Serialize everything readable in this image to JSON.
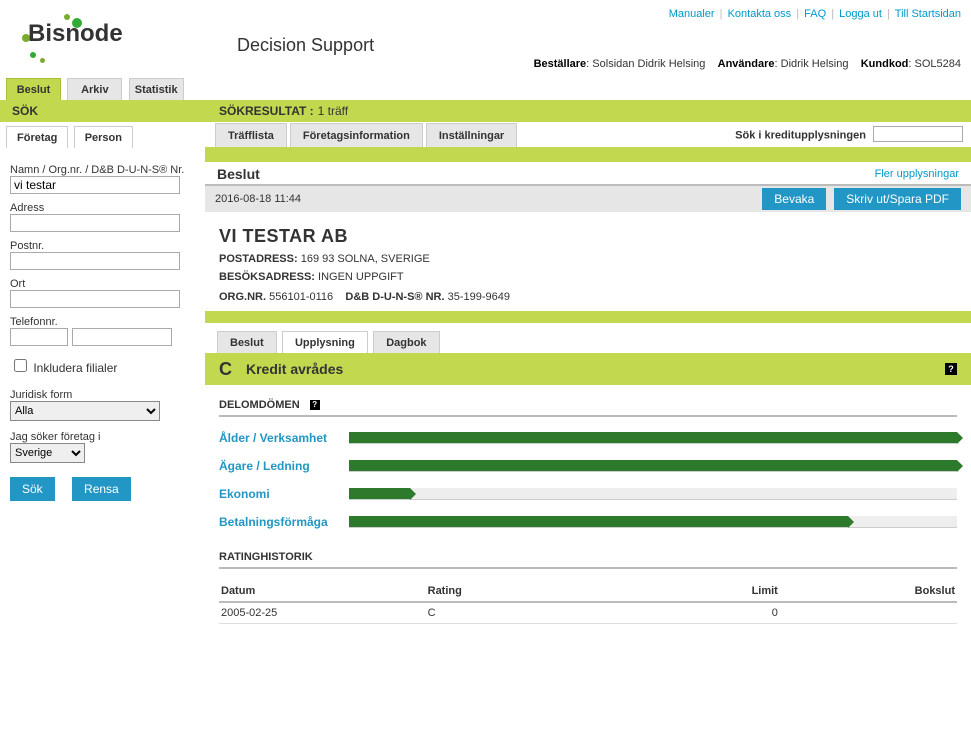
{
  "header": {
    "brand": "Bisnode",
    "app_title": "Decision Support",
    "top_links": [
      "Manualer",
      "Kontakta oss",
      "FAQ",
      "Logga ut",
      "Till Startsidan"
    ],
    "info_labels": {
      "bestallare": "Beställare",
      "anvandare": "Användare",
      "kundkod": "Kundkod"
    },
    "info_values": {
      "bestallare": "Solsidan Didrik Helsing",
      "anvandare": "Didrik Helsing",
      "kundkod": "SOL5284"
    }
  },
  "main_tabs": [
    "Beslut",
    "Arkiv",
    "Statistik"
  ],
  "sidebar": {
    "sok_title": "SÖK",
    "search_tabs": [
      "Företag",
      "Person"
    ],
    "labels": {
      "namn": "Namn / Org.nr. / D&B D-U-N-S® Nr.",
      "adress": "Adress",
      "postnr": "Postnr.",
      "ort": "Ort",
      "telefon": "Telefonnr.",
      "inkludera": "Inkludera filialer",
      "juridisk": "Juridisk form",
      "soker": "Jag söker företag i"
    },
    "values": {
      "namn": "vi testar",
      "juridisk_sel": "Alla",
      "land_sel": "Sverige"
    },
    "buttons": {
      "sok": "Sök",
      "rensa": "Rensa"
    }
  },
  "results": {
    "band_label": "SÖKRESULTAT :",
    "band_count": "1 träff",
    "tabs": [
      "Träfflista",
      "Företagsinformation",
      "Inställningar"
    ],
    "ksearch_label": "Sök i kreditupplysningen",
    "section_title": "Beslut",
    "more_link": "Fler upplysningar",
    "timestamp": "2016-08-18 11:44",
    "buttons": {
      "bevaka": "Bevaka",
      "skriv": "Skriv ut/Spara PDF"
    }
  },
  "company": {
    "name": "VI TESTAR AB",
    "post_label": "POSTADRESS:",
    "post_value": "169 93  SOLNA, SVERIGE",
    "besok_label": "BESÖKSADRESS:",
    "besok_value": "INGEN UPPGIFT",
    "org_label": "ORG.NR.",
    "org_value": "556101-0116",
    "duns_label": "D&B D-U-N-S® NR.",
    "duns_value": "35-199-9649",
    "sub_tabs": [
      "Beslut",
      "Upplysning",
      "Dagbok"
    ],
    "status_code": "C",
    "status_text": "Kredit avrådes",
    "delom_title": "DELOMDÖMEN",
    "bars": [
      {
        "label": "Ålder / Verksamhet",
        "pct": 100
      },
      {
        "label": "Ägare / Ledning",
        "pct": 100
      },
      {
        "label": "Ekonomi",
        "pct": 10
      },
      {
        "label": "Betalningsförmåga",
        "pct": 82
      }
    ],
    "rating_title": "RATINGHISTORIK",
    "rating_columns": [
      "Datum",
      "Rating",
      "Limit",
      "Bokslut"
    ],
    "rating_rows": [
      {
        "datum": "2005-02-25",
        "rating": "C",
        "limit": "0",
        "bokslut": ""
      }
    ]
  }
}
